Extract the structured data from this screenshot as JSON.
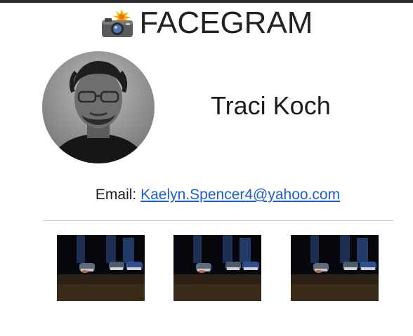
{
  "app": {
    "title": "FACEGRAM",
    "logo_icon": "camera-flash-icon"
  },
  "profile": {
    "name": "Traci Koch",
    "avatar": "profile-photo",
    "email_label": "Email:",
    "email": "Kaelyn.Spencer4@yahoo.com"
  },
  "gallery": {
    "photos": [
      {
        "description_icon": "photo-thumbnail"
      },
      {
        "description_icon": "photo-thumbnail"
      },
      {
        "description_icon": "photo-thumbnail"
      }
    ]
  },
  "colors": {
    "link": "#1a5fd6",
    "top_border": "#2b2b2b",
    "divider": "#cfcfcf"
  }
}
